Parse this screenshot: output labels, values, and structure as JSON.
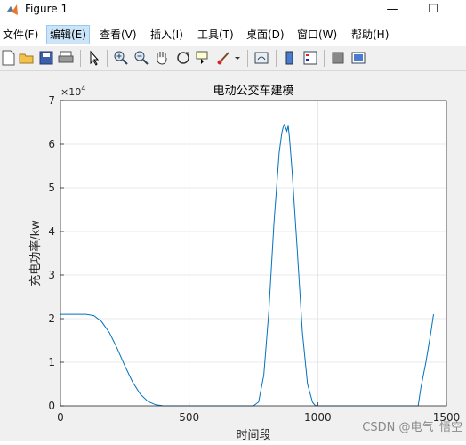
{
  "window": {
    "title": "Figure 1",
    "minimize_glyph": "—",
    "maximize_glyph": "☐"
  },
  "menu": [
    {
      "label": "文件(F)"
    },
    {
      "label": "编辑(E)",
      "active": true
    },
    {
      "label": "查看(V)"
    },
    {
      "label": "插入(I)"
    },
    {
      "label": "工具(T)"
    },
    {
      "label": "桌面(D)"
    },
    {
      "label": "窗口(W)"
    },
    {
      "label": "帮助(H)"
    }
  ],
  "toolbar": {
    "buttons": [
      "new-figure-icon",
      "open-file-icon",
      "save-icon",
      "print-icon",
      "edit-plot-arrow-icon",
      "zoom-in-icon",
      "zoom-out-icon",
      "pan-hand-icon",
      "rotate-3d-icon",
      "data-cursor-icon",
      "brush-icon",
      "link-plot-icon",
      "colorbar-icon",
      "legend-icon",
      "hide-plot-tools-icon",
      "show-plot-tools-icon"
    ]
  },
  "colors": {
    "line": "#0072bd",
    "grid": "#e0e0e0",
    "axes": "#262626",
    "background": "#f0f0f0"
  },
  "chart_data": {
    "type": "line",
    "title": "电动公交车建模",
    "xlabel": "时间段",
    "ylabel": "充电功率/kw",
    "exponent_label": "×10",
    "exponent_power": "4",
    "xlim": [
      0,
      1500
    ],
    "ylim": [
      0,
      70000
    ],
    "xticks": [
      0,
      500,
      1000,
      1500
    ],
    "xtick_labels": [
      "0",
      "500",
      "1000",
      "1500"
    ],
    "yticks": [
      0,
      10000,
      20000,
      30000,
      40000,
      50000,
      60000,
      70000
    ],
    "ytick_labels": [
      "0",
      "1",
      "2",
      "3",
      "4",
      "5",
      "6",
      "7"
    ],
    "grid": true,
    "series": [
      {
        "x": [
          0,
          50,
          100,
          130,
          160,
          190,
          220,
          250,
          280,
          310,
          340,
          370,
          400,
          450,
          500,
          600,
          700,
          750,
          770,
          790,
          810,
          830,
          850,
          860,
          865,
          870,
          875,
          880,
          885,
          890,
          900,
          920,
          940,
          960,
          980,
          990,
          1000,
          1050,
          1100,
          1200,
          1300,
          1380,
          1390,
          1400,
          1420,
          1440,
          1450
        ],
        "y": [
          21000,
          21000,
          21000,
          20700,
          19300,
          16800,
          13200,
          9200,
          5500,
          2700,
          1000,
          250,
          0,
          0,
          0,
          0,
          0,
          0,
          900,
          7000,
          22000,
          42000,
          58000,
          62500,
          63800,
          64500,
          63800,
          63000,
          64200,
          61500,
          54000,
          36000,
          17000,
          5000,
          800,
          100,
          0,
          0,
          0,
          0,
          0,
          0,
          0,
          4000,
          10000,
          17000,
          21000
        ]
      }
    ]
  },
  "watermark": "CSDN @电气_悟空"
}
